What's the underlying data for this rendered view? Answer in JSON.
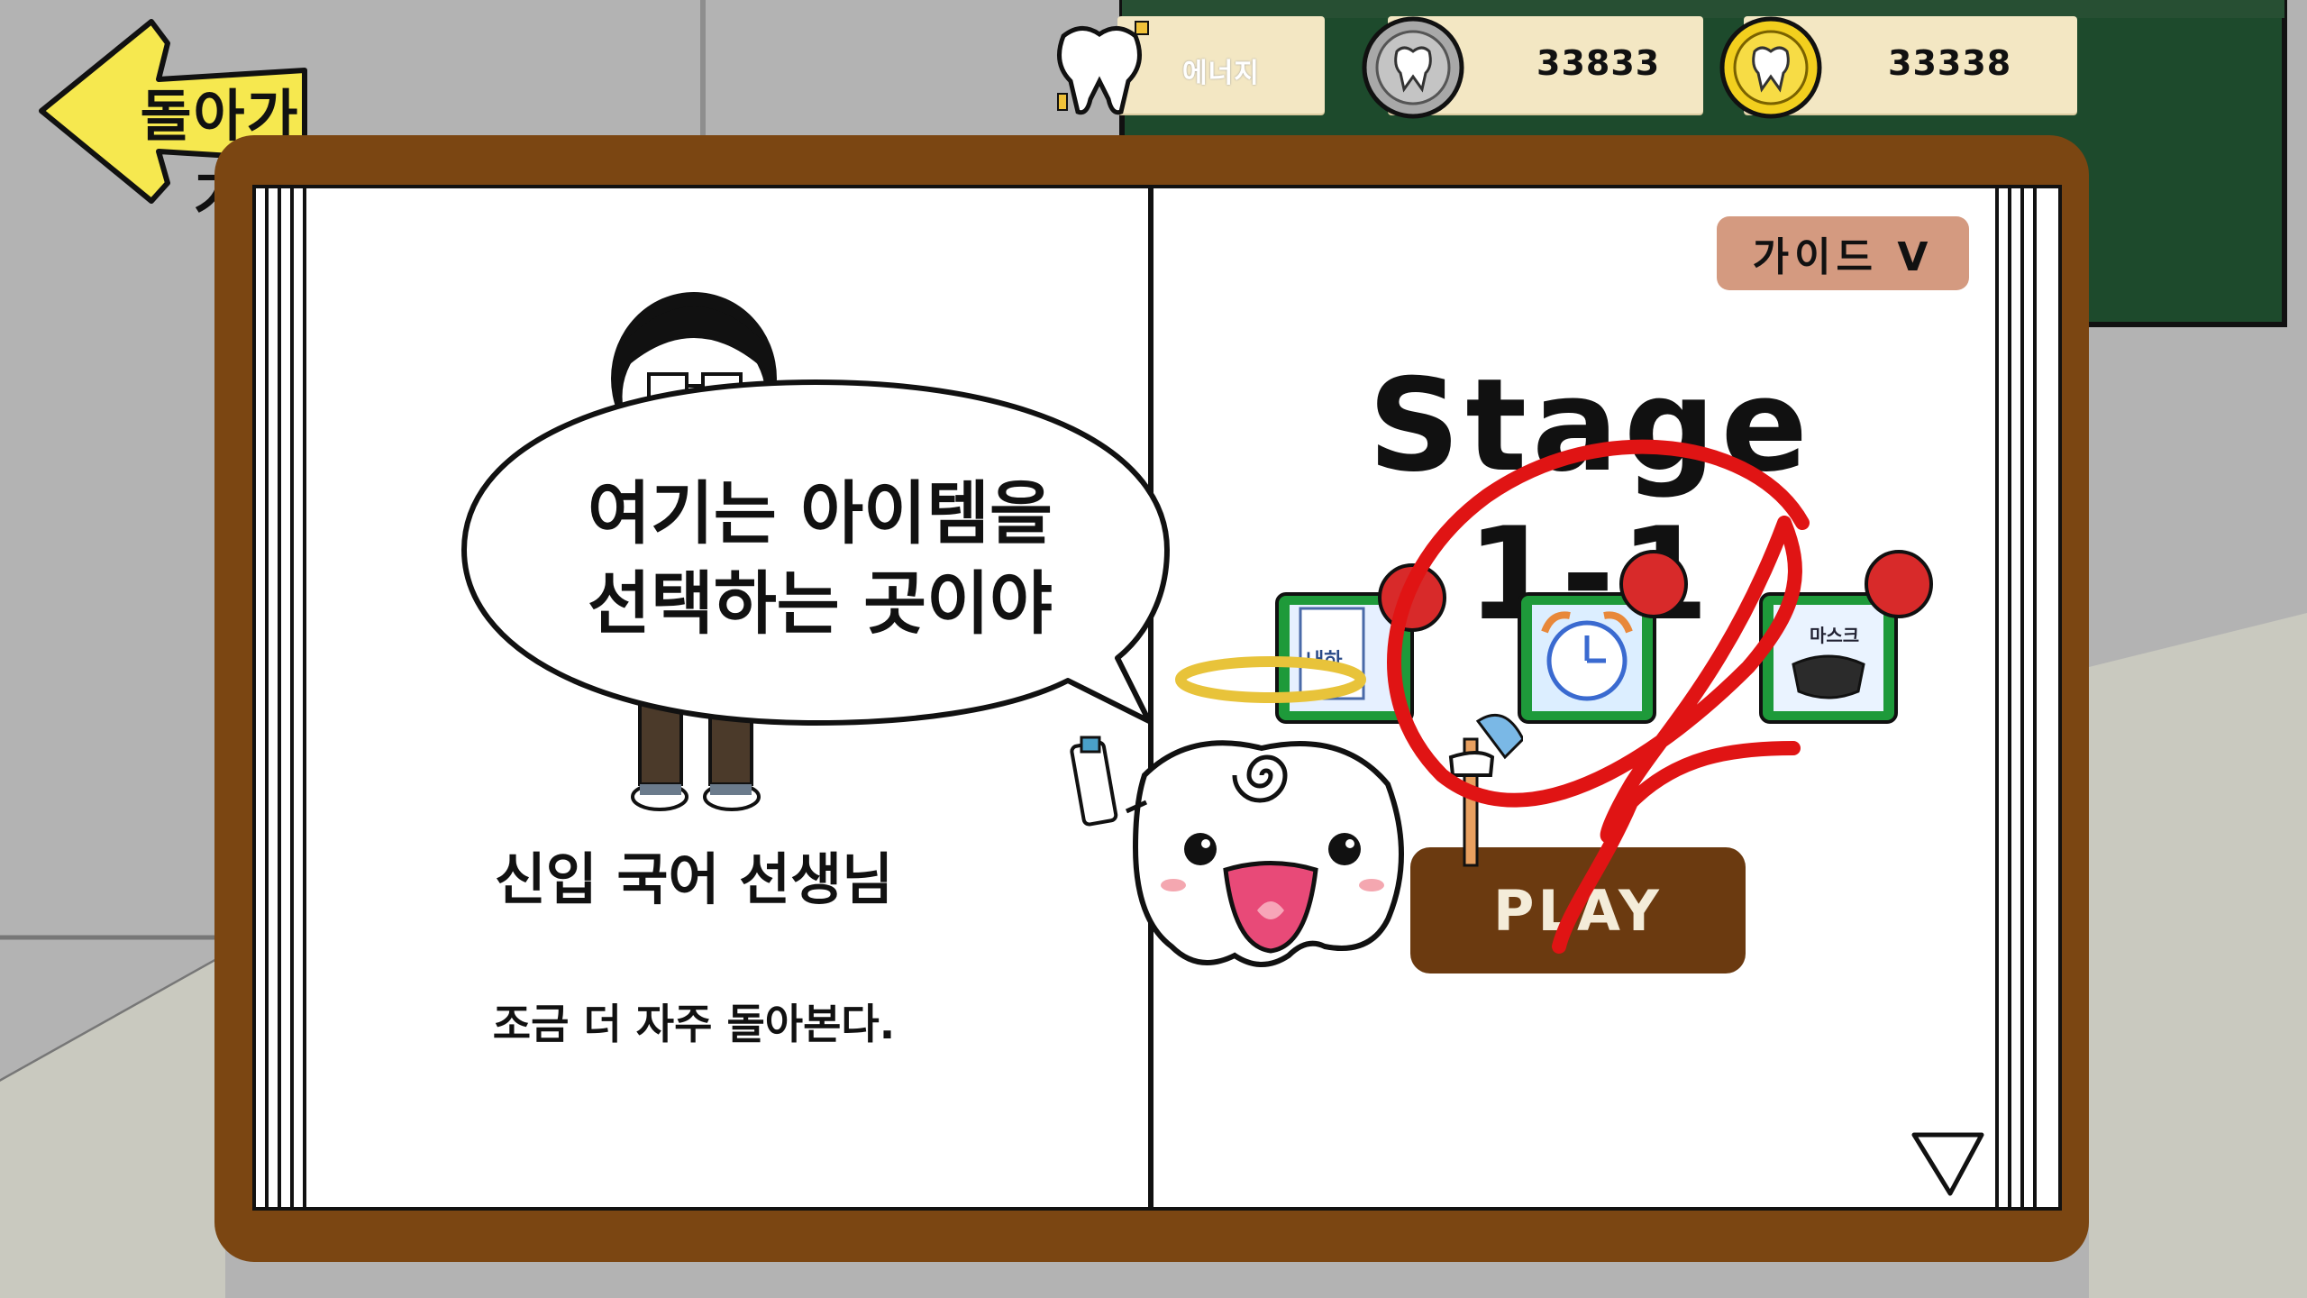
{
  "back_button": {
    "label": "돌아가기"
  },
  "resources": {
    "energy_label": "에너지",
    "silver_coins": "33833",
    "gold_coins": "33338"
  },
  "guide_button": {
    "label": "가이드  V"
  },
  "stage": {
    "title": "Stage 1-1"
  },
  "items": [
    {
      "name": "toothpaste-item-icon",
      "label": "내하"
    },
    {
      "name": "alarm-clock-item-icon"
    },
    {
      "name": "mask-item-icon",
      "label": "마스크"
    }
  ],
  "play_button": {
    "label": "PLAY"
  },
  "teacher": {
    "name": "신입 국어 선생님",
    "description": "조금 더 자주 돌아본다."
  },
  "speech": {
    "line1": "여기는 아이템을",
    "line2": "선택하는 곳이야"
  },
  "colors": {
    "board_frame": "#7b4612",
    "chalkboard": "#1d4a2c",
    "play_button": "#6b3a10",
    "guide_button": "#d49a80",
    "annotation_red": "#e01414",
    "item_badge": "#d82a2a",
    "item_frame": "#1e9a3a"
  }
}
